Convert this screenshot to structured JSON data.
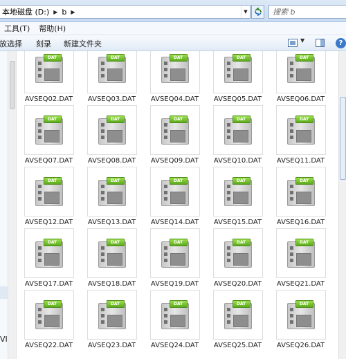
{
  "address_bar": {
    "crumbs": [
      "本地磁盘 (D:)",
      "b"
    ],
    "search_placeholder": "搜索 b"
  },
  "menu": [
    "工具(T)",
    "帮助(H)"
  ],
  "command_bar": {
    "buttons": [
      "播放选择",
      "刻录",
      "新建文件夹"
    ]
  },
  "nav_pane": {
    "partial_text": "VI"
  },
  "files": [
    {
      "name": "AVSEQ02.DAT",
      "icon": "dat-file-icon"
    },
    {
      "name": "AVSEQ03.DAT",
      "icon": "dat-file-icon"
    },
    {
      "name": "AVSEQ04.DAT",
      "icon": "dat-file-icon"
    },
    {
      "name": "AVSEQ05.DAT",
      "icon": "dat-file-icon"
    },
    {
      "name": "AVSEQ06.DAT",
      "icon": "dat-file-icon"
    },
    {
      "name": "AVSEQ07.DAT",
      "icon": "dat-file-icon"
    },
    {
      "name": "AVSEQ08.DAT",
      "icon": "dat-file-icon"
    },
    {
      "name": "AVSEQ09.DAT",
      "icon": "dat-file-icon"
    },
    {
      "name": "AVSEQ10.DAT",
      "icon": "dat-file-icon"
    },
    {
      "name": "AVSEQ11.DAT",
      "icon": "dat-file-icon"
    },
    {
      "name": "AVSEQ12.DAT",
      "icon": "dat-file-icon"
    },
    {
      "name": "AVSEQ13.DAT",
      "icon": "dat-file-icon"
    },
    {
      "name": "AVSEQ14.DAT",
      "icon": "dat-file-icon"
    },
    {
      "name": "AVSEQ15.DAT",
      "icon": "dat-file-icon"
    },
    {
      "name": "AVSEQ16.DAT",
      "icon": "dat-file-icon"
    },
    {
      "name": "AVSEQ17.DAT",
      "icon": "dat-file-icon"
    },
    {
      "name": "AVSEQ18.DAT",
      "icon": "dat-file-icon"
    },
    {
      "name": "AVSEQ19.DAT",
      "icon": "dat-file-icon"
    },
    {
      "name": "AVSEQ20.DAT",
      "icon": "dat-file-icon"
    },
    {
      "name": "AVSEQ21.DAT",
      "icon": "dat-file-icon"
    },
    {
      "name": "AVSEQ22.DAT",
      "icon": "dat-file-icon"
    },
    {
      "name": "AVSEQ23.DAT",
      "icon": "dat-file-icon"
    },
    {
      "name": "AVSEQ24.DAT",
      "icon": "dat-file-icon"
    },
    {
      "name": "AVSEQ25.DAT",
      "icon": "dat-file-icon"
    },
    {
      "name": "AVSEQ26.DAT",
      "icon": "dat-file-icon"
    }
  ],
  "file_badge_text": "DAT",
  "colors": {
    "badge_green": "#5caa1e",
    "chrome_blue": "#dce9f7"
  }
}
